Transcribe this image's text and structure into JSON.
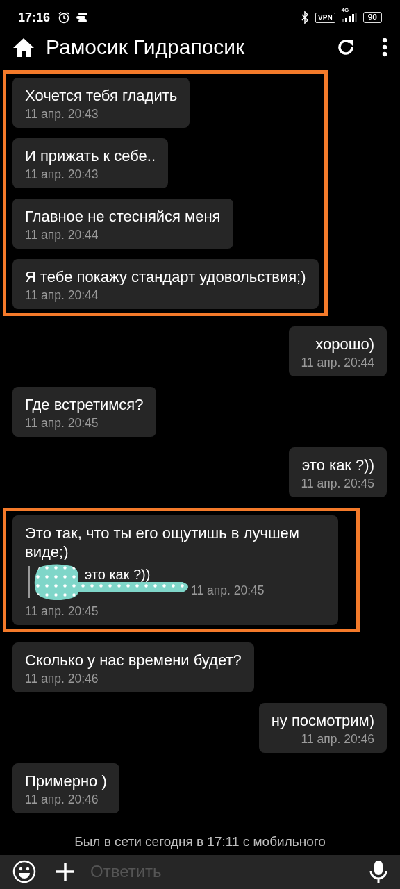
{
  "status_bar": {
    "time": "17:16",
    "vpn": "VPN",
    "network": "4G",
    "battery": "90"
  },
  "header": {
    "title": "Рамосик Гидрапосик"
  },
  "thread": [
    {
      "kind": "highlight",
      "messages": [
        {
          "text": "Хочется тебя гладить",
          "time": "11 апр. 20:43",
          "outgoing": false
        },
        {
          "text": "И прижать к себе..",
          "time": "11 апр. 20:43",
          "outgoing": false
        },
        {
          "text": "Главное не стесняйся меня",
          "time": "11 апр. 20:44",
          "outgoing": false
        },
        {
          "text": "Я тебе покажу стандарт удовольствия;)",
          "time": "11 апр. 20:44",
          "outgoing": false
        }
      ]
    },
    {
      "kind": "message",
      "messages": [
        {
          "text": "хорошо)",
          "time": "11 апр. 20:44",
          "outgoing": true
        }
      ]
    },
    {
      "kind": "message",
      "messages": [
        {
          "text": "Где встретимся?",
          "time": "11 апр. 20:45",
          "outgoing": false
        }
      ]
    },
    {
      "kind": "message",
      "messages": [
        {
          "text": "это как ?))",
          "time": "11 апр. 20:45",
          "outgoing": true
        }
      ]
    },
    {
      "kind": "highlight",
      "messages": [
        {
          "text": "Это так, что ты его ощутишь в лучшем виде;)",
          "time": "11 апр. 20:45",
          "outgoing": false,
          "reply": {
            "text": "это как ?))",
            "time": "11 апр. 20:45",
            "redacted": true
          }
        }
      ]
    },
    {
      "kind": "message",
      "messages": [
        {
          "text": "Сколько у нас времени будет?",
          "time": "11 апр. 20:46",
          "outgoing": false
        }
      ]
    },
    {
      "kind": "message",
      "messages": [
        {
          "text": "ну посмотрим)",
          "time": "11 апр. 20:46",
          "outgoing": true
        }
      ]
    },
    {
      "kind": "message",
      "messages": [
        {
          "text": "Примерно )",
          "time": "11 апр. 20:46",
          "outgoing": false
        }
      ]
    }
  ],
  "last_seen": "Был в сети сегодня в 17:11 с мобильного",
  "composer": {
    "placeholder": "Ответить"
  }
}
